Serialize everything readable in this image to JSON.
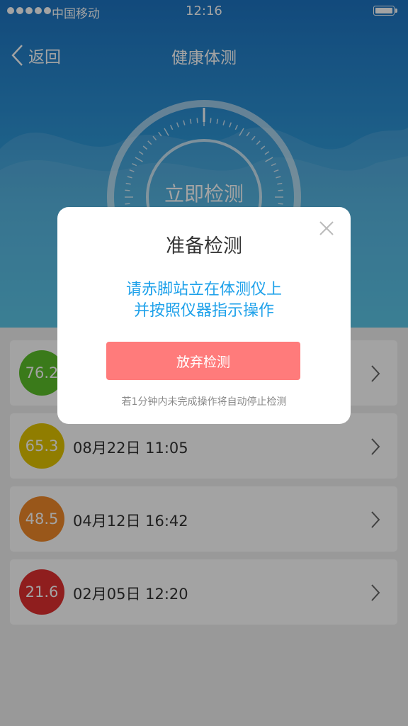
{
  "status_bar": {
    "carrier": "中国移动",
    "time": "12:16",
    "signal_dots": 5,
    "battery_level": 1.0
  },
  "nav": {
    "back_label": "返回",
    "back_icon": "chevron-left-icon",
    "title": "健康体测"
  },
  "hero": {
    "start_label": "立即检测"
  },
  "records": [
    {
      "score": "76.2",
      "date": "",
      "color": "#5cbf2a"
    },
    {
      "score": "65.3",
      "date": "08月22日 11:05",
      "color": "#e2c400"
    },
    {
      "score": "48.5",
      "date": "04月12日 16:42",
      "color": "#f0892a"
    },
    {
      "score": "21.6",
      "date": "02月05日 12:20",
      "color": "#e03030"
    }
  ],
  "modal": {
    "title": "准备检测",
    "instruction_line1": "请赤脚站立在体测仪上",
    "instruction_line2": "并按照仪器指示操作",
    "button_label": "放弃检测",
    "note": "若1分钟内未完成操作将自动停止检测",
    "close_icon": "close-icon"
  },
  "colors": {
    "accent_blue": "#1ea1ea",
    "button_red": "#ff7b7b",
    "header_blue": "#1d74c2"
  }
}
